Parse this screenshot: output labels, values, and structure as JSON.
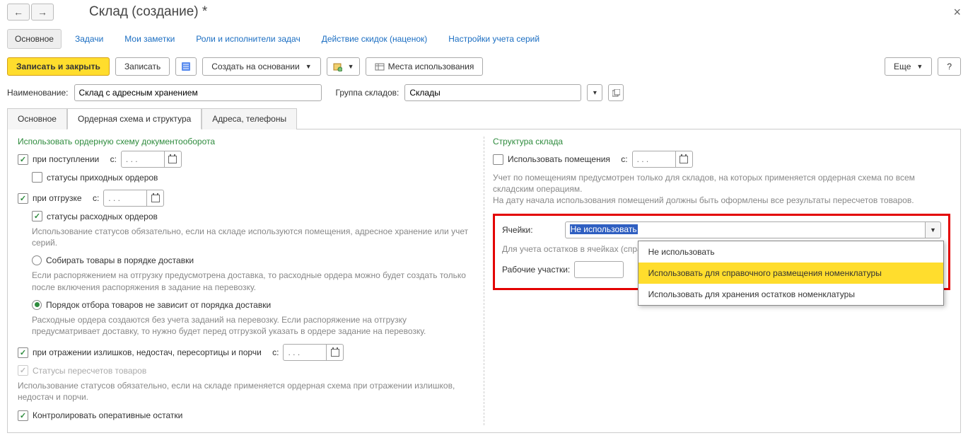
{
  "title": "Склад (создание) *",
  "navtabs": [
    "Основное",
    "Задачи",
    "Мои заметки",
    "Роли и исполнители задач",
    "Действие скидок (наценок)",
    "Настройки учета серий"
  ],
  "toolbar": {
    "save_close": "Записать и закрыть",
    "save": "Записать",
    "create_based": "Создать на основании",
    "usage": "Места использования",
    "more": "Еще",
    "help": "?"
  },
  "name_label": "Наименование:",
  "name_value": "Склад с адресным хранением",
  "group_label": "Группа складов:",
  "group_value": "Склады",
  "inner_tabs": [
    "Основное",
    "Ордерная схема и структура",
    "Адреса, телефоны"
  ],
  "left": {
    "title": "Использовать ордерную схему документооборота",
    "on_receive": "при поступлении",
    "from": "с:",
    "date_ph": ". . .",
    "status_in": "статусы приходных ордеров",
    "on_ship": "при отгрузке",
    "status_out": "статусы расходных ордеров",
    "status_out_note": "Использование статусов обязательно, если на складе используются помещения, адресное хранение или учет серий.",
    "radio1": "Собирать товары в порядке доставки",
    "radio1_note": "Если распоряжением на отгрузку предусмотрена доставка, то расходные ордера можно будет создать только после включения распоряжения в задание на перевозку.",
    "radio2": "Порядок отбора товаров не зависит от порядка доставки",
    "radio2_note": "Расходные ордера создаются без учета заданий на перевозку. Если распоряжение на отгрузку предусматривает доставку, то нужно будет перед отгрузкой указать в ордере задание на перевозку.",
    "on_surplus": "при отражении излишков, недостач, пересортицы и порчи",
    "status_recount": "Статусы пересчетов товаров",
    "status_recount_note": "Использование статусов обязательно, если на складе применяется ордерная схема при отражении излишков, недостач и порчи.",
    "control": "Контролировать оперативные остатки"
  },
  "right": {
    "title": "Структура склада",
    "use_rooms": "Использовать помещения",
    "from": "с:",
    "date_ph": ". . .",
    "rooms_note": "Учет по помещениям предусмотрен только для складов, на которых применяется ордерная схема по всем складским операциям.\nНа дату начала использования помещений должны быть оформлены все результаты пересчетов товаров.",
    "cells_label": "Ячейки:",
    "cells_value": "Не использовать",
    "cells_options": [
      "Не использовать",
      "Использовать для справочного размещения номенклатуры",
      "Использовать для хранения остатков номенклатуры"
    ],
    "cells_note": "Для учета остатков в ячейках (справочно или с указанием остатков) будет использоваться ордерной схемы по",
    "areas_label": "Рабочие участки:"
  }
}
